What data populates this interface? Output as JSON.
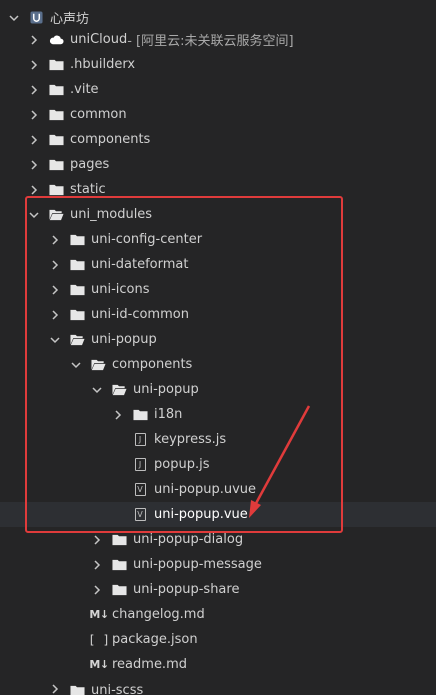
{
  "project": {
    "title": "心声坊"
  },
  "items": [
    {
      "label": "uniCloud",
      "suffix": " - [阿里云:未关联云服务空间]"
    },
    {
      "label": ".hbuilderx"
    },
    {
      "label": ".vite"
    },
    {
      "label": "common"
    },
    {
      "label": "components"
    },
    {
      "label": "pages"
    },
    {
      "label": "static"
    },
    {
      "label": "uni_modules"
    },
    {
      "label": "uni-config-center"
    },
    {
      "label": "uni-dateformat"
    },
    {
      "label": "uni-icons"
    },
    {
      "label": "uni-id-common"
    },
    {
      "label": "uni-popup"
    },
    {
      "label": "components"
    },
    {
      "label": "uni-popup"
    },
    {
      "label": "i18n"
    },
    {
      "label": "keypress.js"
    },
    {
      "label": "popup.js"
    },
    {
      "label": "uni-popup.uvue"
    },
    {
      "label": "uni-popup.vue"
    },
    {
      "label": "uni-popup-dialog"
    },
    {
      "label": "uni-popup-message"
    },
    {
      "label": "uni-popup-share"
    },
    {
      "label": "changelog.md"
    },
    {
      "label": "package.json"
    },
    {
      "label": "readme.md"
    },
    {
      "label": "uni-scss"
    }
  ],
  "icons": {
    "js": "J",
    "vue": "V",
    "md": "M↓",
    "json": "[ ]"
  },
  "colors": {
    "highlight": "#e03b3b",
    "background": "#252526",
    "selected": "#2d2f33"
  }
}
